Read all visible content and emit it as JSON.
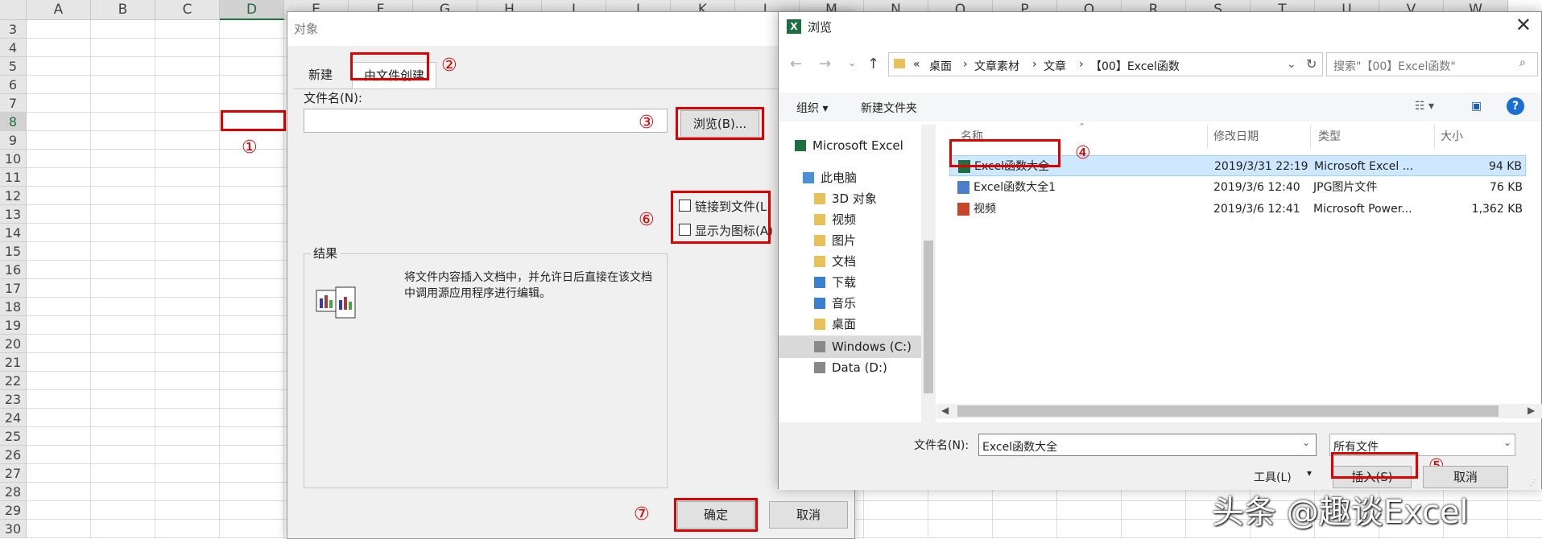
{
  "sheet": {
    "columns": [
      "A",
      "B",
      "C",
      "D",
      "E",
      "F",
      "G",
      "H",
      "I",
      "J",
      "K",
      "L",
      "M",
      "N",
      "O",
      "P",
      "Q",
      "R",
      "S",
      "T",
      "U",
      "V",
      "W"
    ],
    "rows": [
      "3",
      "4",
      "5",
      "6",
      "7",
      "8",
      "9",
      "10",
      "11",
      "12",
      "13",
      "14",
      "15",
      "16",
      "17",
      "18",
      "19",
      "20",
      "21",
      "22",
      "23",
      "24",
      "25",
      "26",
      "27",
      "28",
      "29",
      "30"
    ],
    "selected_column": "D",
    "selected_row": "8"
  },
  "annotations": {
    "n1": "①",
    "n2": "②",
    "n3": "③",
    "n4": "④",
    "n5": "⑤",
    "n6": "⑥",
    "n7": "⑦",
    "color": "#e00000"
  },
  "object_dialog": {
    "title": "对象",
    "tabs": [
      "新建",
      "由文件创建"
    ],
    "filename_label": "文件名(N):",
    "filename_value": "",
    "browse_button": "浏览(B)...",
    "link_checkbox": "链接到文件(L)",
    "icon_checkbox": "显示为图标(A)",
    "result_label": "结果",
    "result_text": "将文件内容插入文档中，并允许日后直接在该文档中调用源应用程序进行编辑。",
    "ok_button": "确定",
    "cancel_button": "取消"
  },
  "browse_dialog": {
    "title": "浏览",
    "breadcrumb": [
      "«",
      "桌面",
      "文章素材",
      "文章",
      "【00】Excel函数"
    ],
    "search_placeholder": "搜索\"【00】Excel函数\"",
    "toolbar": {
      "organize": "组织 ▾",
      "new_folder": "新建文件夹"
    },
    "nav_items": [
      {
        "label": "Microsoft Excel",
        "icon": "excel-icon"
      },
      {
        "label": "此电脑",
        "icon": "computer-icon"
      },
      {
        "label": "3D 对象",
        "icon": "folder-icon"
      },
      {
        "label": "视频",
        "icon": "folder-icon"
      },
      {
        "label": "图片",
        "icon": "folder-icon"
      },
      {
        "label": "文档",
        "icon": "folder-icon"
      },
      {
        "label": "下载",
        "icon": "download-icon"
      },
      {
        "label": "音乐",
        "icon": "music-icon"
      },
      {
        "label": "桌面",
        "icon": "folder-icon"
      },
      {
        "label": "Windows (C:)",
        "icon": "drive-icon"
      },
      {
        "label": "Data (D:)",
        "icon": "drive-icon"
      }
    ],
    "columns": {
      "name": "名称",
      "date": "修改日期",
      "type": "类型",
      "size": "大小"
    },
    "files": [
      {
        "name": "Excel函数大全",
        "date": "2019/3/31 22:19",
        "type": "Microsoft Excel ...",
        "size": "94 KB",
        "icon": "excel-file-icon"
      },
      {
        "name": "Excel函数大全1",
        "date": "2019/3/6 12:40",
        "type": "JPG图片文件",
        "size": "76 KB",
        "icon": "image-file-icon"
      },
      {
        "name": "视频",
        "date": "2019/3/6 12:41",
        "type": "Microsoft Power...",
        "size": "1,362 KB",
        "icon": "powerpoint-file-icon"
      }
    ],
    "filename_label": "文件名(N):",
    "filename_value": "Excel函数大全",
    "filetype_value": "所有文件",
    "tools_label": "工具(L)",
    "insert_button": "插入(S)",
    "cancel_button": "取消"
  },
  "watermark": "头条 @趣谈Excel"
}
